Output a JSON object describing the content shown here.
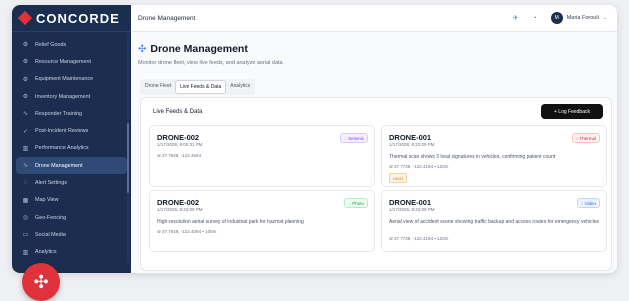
{
  "brand": {
    "name": "CONCORDE"
  },
  "sidebar": {
    "items": [
      {
        "label": "Relief Goods",
        "icon": "relief-goods-icon",
        "glyph": "⚙"
      },
      {
        "label": "Resource Management",
        "icon": "resource-icon",
        "glyph": "⚙"
      },
      {
        "label": "Equipment Maintenance",
        "icon": "wrench-icon",
        "glyph": "⚙"
      },
      {
        "label": "Inventory Management",
        "icon": "inventory-icon",
        "glyph": "⚙"
      },
      {
        "label": "Responder Training",
        "icon": "activity-icon",
        "glyph": "∿"
      },
      {
        "label": "Post-Incident Reviews",
        "icon": "review-icon",
        "glyph": "✓"
      },
      {
        "label": "Performance Analytics",
        "icon": "chart-icon",
        "glyph": "▥"
      },
      {
        "label": "Drone Management",
        "icon": "drone-icon",
        "glyph": "∿",
        "active": true
      },
      {
        "label": "Alert Settings",
        "icon": "bell-icon",
        "glyph": "◌"
      },
      {
        "label": "Map View",
        "icon": "map-icon",
        "glyph": "▦"
      },
      {
        "label": "Geo-Fencing",
        "icon": "geofence-icon",
        "glyph": "◎"
      },
      {
        "label": "Social Media",
        "icon": "chat-icon",
        "glyph": "▭"
      },
      {
        "label": "Analytics",
        "icon": "analytics-icon",
        "glyph": "▥"
      }
    ]
  },
  "topbar": {
    "title": "Drone Management",
    "user_name": "Maria Forouli",
    "user_initial": "M"
  },
  "page": {
    "title": "Drone Management",
    "subtitle": "Monitor drone fleet, view live feeds, and analyze aerial data"
  },
  "tabs": [
    "Drone Fleet",
    "Live Feeds & Data",
    "Analytics"
  ],
  "panel": {
    "title": "Live Feeds & Data",
    "log_button": "+ Log Feedback"
  },
  "feeds": [
    {
      "id": "DRONE-002",
      "time": "1/17/2026, 9:00:31 PM",
      "badge": "Seismic",
      "desc": "",
      "location": "37.7649, -122.4694",
      "tag": ""
    },
    {
      "id": "DRONE-001",
      "time": "1/17/2026, 8:22:09 PM",
      "badge": "Thermal",
      "desc": "Thermal scan shows 3 heat signatures in vehicles, confirming patient count",
      "location": "37.7749, -122.4194 • 120m",
      "tag": "HIGH"
    },
    {
      "id": "DRONE-002",
      "time": "1/17/2026, 8:22:09 PM",
      "badge": "Photo",
      "desc": "High-resolution aerial survey of industrial park for hazmat planning",
      "location": "37.7649, -122.4094 • 100m",
      "tag": ""
    },
    {
      "id": "DRONE-001",
      "time": "1/17/2026, 8:22:09 PM",
      "badge": "Video",
      "desc": "Aerial view of accident scene showing traffic backup and access routes for emergency vehicles",
      "location": "37.7749, -122.4194 • 120m",
      "tag": ""
    }
  ]
}
